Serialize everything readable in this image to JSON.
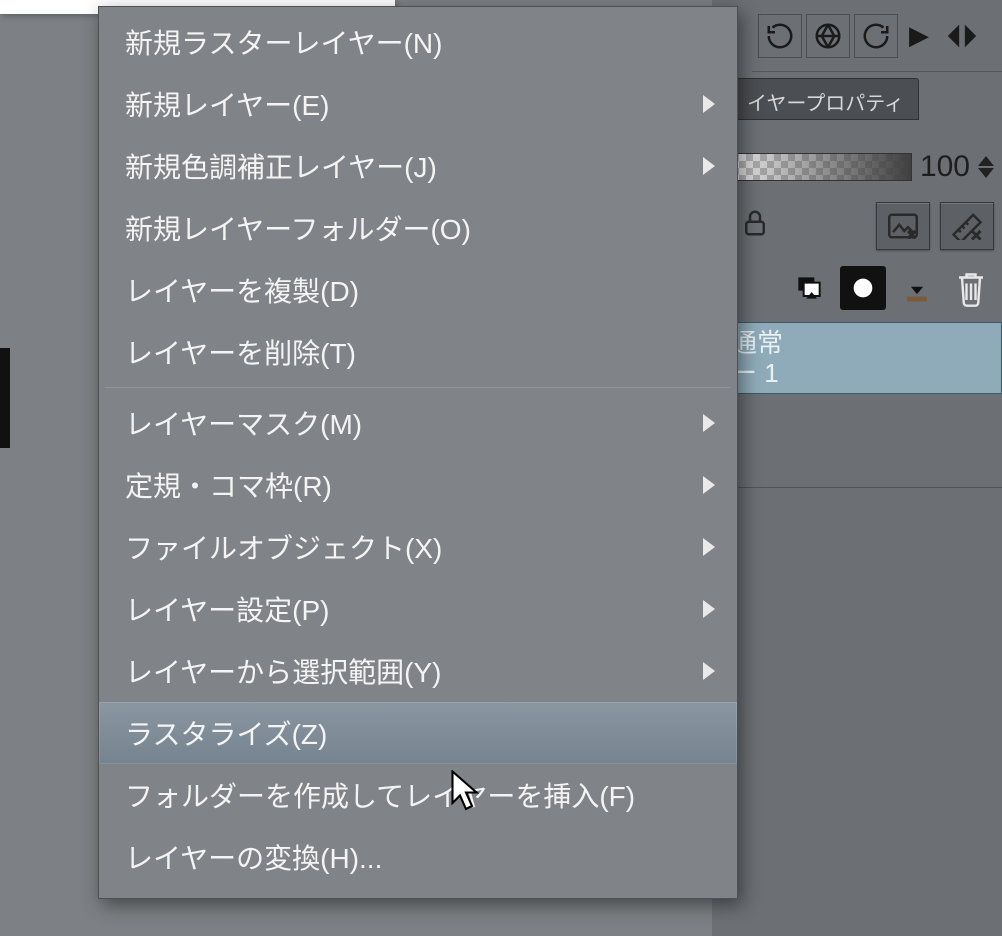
{
  "menu": {
    "items": [
      {
        "label": "新規ラスターレイヤー(N)",
        "submenu": false
      },
      {
        "label": "新規レイヤー(E)",
        "submenu": true
      },
      {
        "label": "新規色調補正レイヤー(J)",
        "submenu": true
      },
      {
        "label": "新規レイヤーフォルダー(O)",
        "submenu": false
      },
      {
        "label": "レイヤーを複製(D)",
        "submenu": false
      },
      {
        "label": "レイヤーを削除(T)",
        "submenu": false
      }
    ],
    "items2": [
      {
        "label": "レイヤーマスク(M)",
        "submenu": true
      },
      {
        "label": "定規・コマ枠(R)",
        "submenu": true
      },
      {
        "label": "ファイルオブジェクト(X)",
        "submenu": true
      },
      {
        "label": "レイヤー設定(P)",
        "submenu": true
      },
      {
        "label": "レイヤーから選択範囲(Y)",
        "submenu": true
      },
      {
        "label": "ラスタライズ(Z)",
        "submenu": false,
        "highlight": true
      },
      {
        "label": "フォルダーを作成してレイヤーを挿入(F)",
        "submenu": false
      },
      {
        "label": "レイヤーの変換(H)...",
        "submenu": false
      }
    ]
  },
  "right_panel": {
    "tab_label": "イヤープロパティ",
    "opacity_value": "100",
    "layer_mode": "通常",
    "layer_name": "ー 1"
  }
}
